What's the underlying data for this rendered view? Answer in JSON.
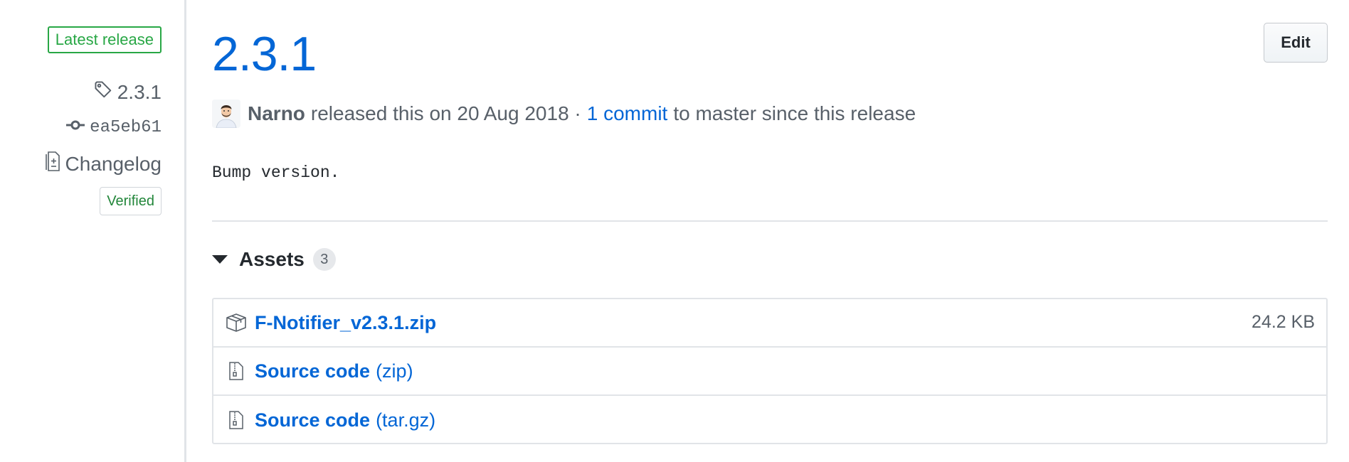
{
  "sidebar": {
    "latest_badge": "Latest release",
    "tag_name": "2.3.1",
    "commit_sha": "ea5eb61",
    "changelog_label": "Changelog",
    "verified_label": "Verified"
  },
  "release": {
    "title": "2.3.1",
    "edit_label": "Edit",
    "author": "Narno",
    "released_text": "released this on 20 Aug 2018 ·",
    "commits_link": "1 commit",
    "commits_suffix": "to master since this release",
    "notes": "Bump version."
  },
  "assets": {
    "label": "Assets",
    "count": "3",
    "items": [
      {
        "name": "F-Notifier_v2.3.1.zip",
        "suffix": "",
        "size": "24.2 KB",
        "icon": "package-icon"
      },
      {
        "name": "Source code",
        "suffix": "(zip)",
        "size": "",
        "icon": "file-zip-icon"
      },
      {
        "name": "Source code",
        "suffix": "(tar.gz)",
        "size": "",
        "icon": "file-zip-icon"
      }
    ]
  },
  "colors": {
    "link": "#0366d6",
    "latest_green": "#28a745",
    "verified_green": "#22863a",
    "muted_text": "#586069",
    "border": "#e1e4e8"
  }
}
